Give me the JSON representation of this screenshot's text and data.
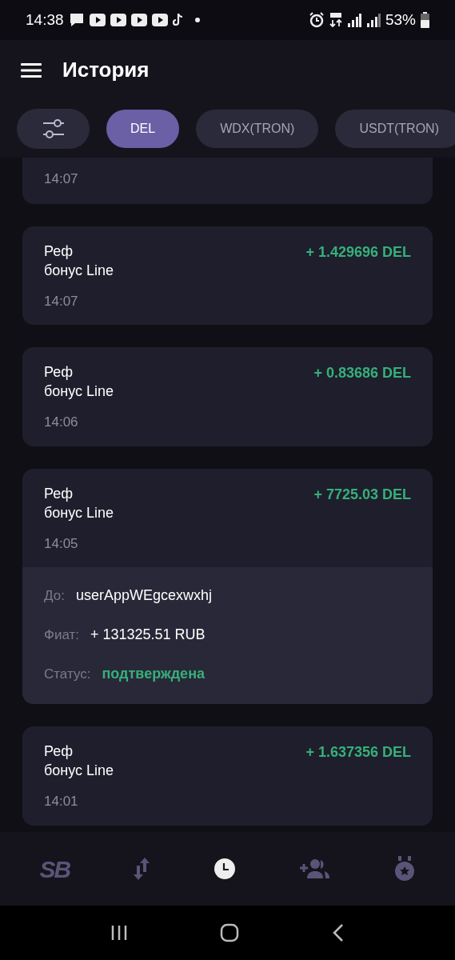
{
  "status_bar": {
    "time": "14:38",
    "battery": "53%"
  },
  "header": {
    "title": "История"
  },
  "filters": [
    {
      "label": "DEL",
      "selected": true
    },
    {
      "label": "WDX(TRON)",
      "selected": false
    },
    {
      "label": "USDT(TRON)",
      "selected": false
    }
  ],
  "transactions": [
    {
      "kind": "partial",
      "time": "14:07"
    },
    {
      "kind": "full",
      "title": "Реф\nбонус Line",
      "amount": "+ 1.429696 DEL",
      "time": "14:07"
    },
    {
      "kind": "full",
      "title": "Реф\nбонус Line",
      "amount": "+ 0.83686 DEL",
      "time": "14:06"
    },
    {
      "kind": "full",
      "title": "Реф\nбонус Line",
      "amount": "+ 7725.03 DEL",
      "time": "14:05",
      "details": [
        {
          "label": "До:",
          "value": "userAppWEgcexwxhj",
          "kind": "plain"
        },
        {
          "label": "Фиат:",
          "value": "+ 131325.51 RUB",
          "kind": "plain"
        },
        {
          "label": "Статус:",
          "value": "подтверждена",
          "kind": "status"
        }
      ]
    },
    {
      "kind": "full",
      "title": "Реф\nбонус Line",
      "amount": "+ 1.637356 DEL",
      "time": "14:01"
    }
  ],
  "bottom_nav": [
    {
      "kind": "logo",
      "label": "SB",
      "selected": false
    },
    {
      "kind": "transfer",
      "selected": false
    },
    {
      "kind": "history",
      "selected": true
    },
    {
      "kind": "invite",
      "selected": false
    },
    {
      "kind": "medal",
      "selected": false
    }
  ]
}
